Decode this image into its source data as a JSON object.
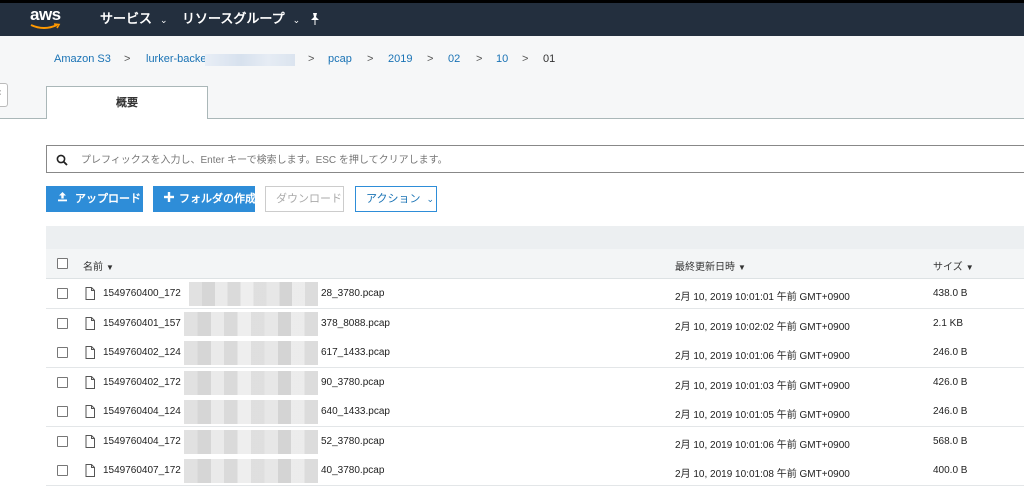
{
  "nav": {
    "logo_text": "aws",
    "services_label": "サービス",
    "resource_groups_label": "リソースグループ"
  },
  "breadcrumb": {
    "items": [
      "Amazon S3",
      "lurker-backe",
      "pcap",
      "2019",
      "02",
      "10",
      "01"
    ],
    "separator": ">"
  },
  "tabs": [
    {
      "label": "概要"
    }
  ],
  "search": {
    "placeholder": "プレフィックスを入力し、Enter キーで検索します。ESC を押してクリアします。"
  },
  "toolbar": {
    "upload_label": "アップロード",
    "create_folder_label": "フォルダの作成",
    "download_label": "ダウンロード",
    "actions_label": "アクション"
  },
  "table": {
    "columns": [
      "名前",
      "最終更新日時",
      "サイズ"
    ],
    "rows": [
      {
        "name_prefix": "1549760400_172",
        "name_suffix": "28_3780.pcap",
        "modified": "2月 10, 2019 10:01:01 午前 GMT+0900",
        "size": "438.0 B"
      },
      {
        "name_prefix": "1549760401_157",
        "name_suffix": "378_8088.pcap",
        "modified": "2月 10, 2019 10:02:02 午前 GMT+0900",
        "size": "2.1 KB"
      },
      {
        "name_prefix": "1549760402_124",
        "name_suffix": "617_1433.pcap",
        "modified": "2月 10, 2019 10:01:06 午前 GMT+0900",
        "size": "246.0 B"
      },
      {
        "name_prefix": "1549760402_172",
        "name_suffix": "90_3780.pcap",
        "modified": "2月 10, 2019 10:01:03 午前 GMT+0900",
        "size": "426.0 B"
      },
      {
        "name_prefix": "1549760404_124",
        "name_suffix": "640_1433.pcap",
        "modified": "2月 10, 2019 10:01:05 午前 GMT+0900",
        "size": "246.0 B"
      },
      {
        "name_prefix": "1549760404_172",
        "name_suffix": "52_3780.pcap",
        "modified": "2月 10, 2019 10:01:06 午前 GMT+0900",
        "size": "568.0 B"
      },
      {
        "name_prefix": "1549760407_172",
        "name_suffix": "40_3780.pcap",
        "modified": "2月 10, 2019 10:01:08 午前 GMT+0900",
        "size": "400.0 B"
      }
    ]
  },
  "colors": {
    "nav_bg": "#232f3e",
    "accent_orange": "#ff9900",
    "primary_button": "#2e8dd8",
    "link": "#1a73b5"
  },
  "icons": [
    "aws-logo",
    "chevron-down-icon",
    "pin-icon",
    "search-icon",
    "upload-icon",
    "plus-icon",
    "file-icon",
    "sort-caret-icon"
  ]
}
